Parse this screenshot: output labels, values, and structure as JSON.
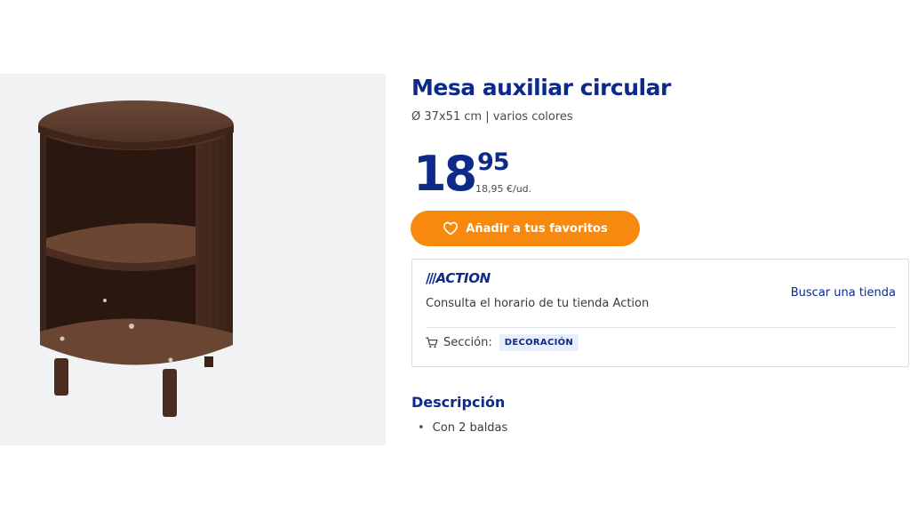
{
  "product": {
    "title": "Mesa auxiliar circular",
    "subtitle": "Ø 37x51 cm | varios colores",
    "image_alt": "round-wooden-side-table",
    "price": {
      "integer": "18",
      "decimals": "95",
      "unit": "18,95 €/ud."
    },
    "favorite_button": {
      "label": "Añadir a tus favoritos",
      "icon": "heart-icon"
    }
  },
  "store": {
    "logo": {
      "stripes": "///",
      "text": "ACTION"
    },
    "schedule_text": "Consulta el horario de tu tienda Action",
    "find_store_link": "Buscar una tienda",
    "section_label": "Sección:",
    "section_value": "DECORACIÓN",
    "section_icon": "cart-icon"
  },
  "description": {
    "heading": "Descripción",
    "items": [
      "Con 2 baldas"
    ]
  },
  "colors": {
    "brand_blue": "#0d2a8a",
    "accent_orange": "#f7890f",
    "image_background": "#f1f2f4",
    "badge_background": "#e7eefc"
  }
}
